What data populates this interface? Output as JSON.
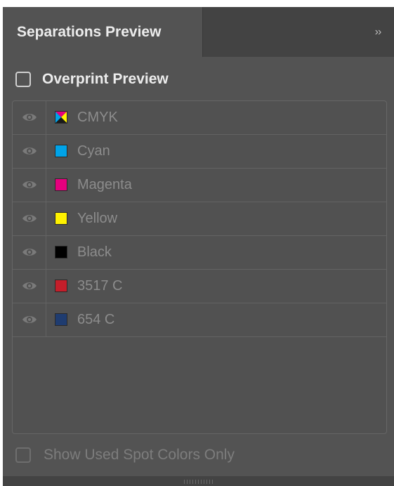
{
  "panel": {
    "tab_title": "Separations Preview",
    "collapse_glyph": "››"
  },
  "overprint": {
    "label": "Overprint Preview",
    "checked": false
  },
  "separations": [
    {
      "name": "CMYK",
      "swatch": "cmyk-icon",
      "color": "#000000",
      "visible": true
    },
    {
      "name": "Cyan",
      "swatch": "solid",
      "color": "#00a3e8",
      "visible": true
    },
    {
      "name": "Magenta",
      "swatch": "solid",
      "color": "#e6007e",
      "visible": true
    },
    {
      "name": "Yellow",
      "swatch": "solid",
      "color": "#fff200",
      "visible": true
    },
    {
      "name": "Black",
      "swatch": "solid",
      "color": "#000000",
      "visible": true
    },
    {
      "name": "3517 C",
      "swatch": "solid",
      "color": "#c41e2a",
      "visible": true
    },
    {
      "name": "654 C",
      "swatch": "solid",
      "color": "#1f3c70",
      "visible": true
    }
  ],
  "spot_only": {
    "label": "Show Used Spot Colors Only",
    "checked": false,
    "enabled": false
  }
}
